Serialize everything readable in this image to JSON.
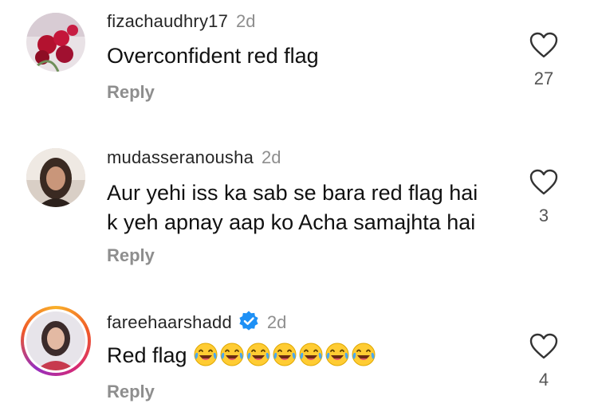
{
  "comments": [
    {
      "username": "fizachaudhry17",
      "time": "2d",
      "text_lines": [
        "Overconfident red flag"
      ],
      "reply_label": "Reply",
      "likes": "27",
      "verified": false
    },
    {
      "username": "mudasseranousha",
      "time": "2d",
      "text_lines": [
        "Aur yehi iss ka sab se bara red flag hai",
        "k yeh apnay aap ko Acha samajhta hai"
      ],
      "reply_label": "Reply",
      "likes": "3",
      "verified": false
    },
    {
      "username": "fareehaarshadd",
      "time": "2d",
      "text_lines": [
        "Red flag"
      ],
      "emoji": [
        "😂",
        "😂",
        "😂",
        "😂",
        "😂",
        "😂",
        "😂"
      ],
      "reply_label": "Reply",
      "likes": "4",
      "verified": true
    }
  ],
  "icons": {
    "like": "heart-outline-icon",
    "verified": "verified-badge-icon",
    "emoji": "face-with-tears-of-joy"
  },
  "colors": {
    "username": "#262626",
    "muted": "#8e8e8e",
    "verified": "#1e90f5",
    "story_ring": [
      "#f9b12a",
      "#f05a28",
      "#d62976",
      "#962fbf"
    ]
  }
}
